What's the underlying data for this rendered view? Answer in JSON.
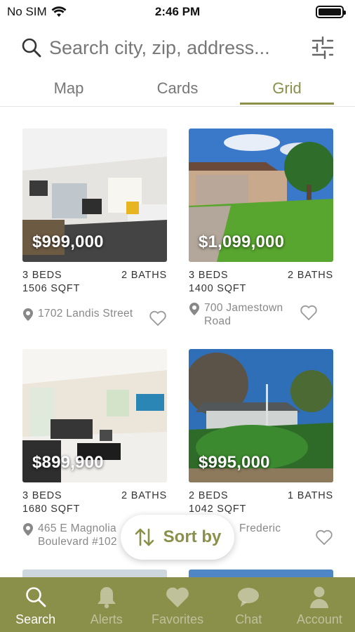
{
  "status_bar": {
    "carrier": "No SIM",
    "time": "2:46 PM"
  },
  "search": {
    "placeholder": "Search city, zip, address..."
  },
  "tabs": [
    {
      "label": "Map",
      "active": false
    },
    {
      "label": "Cards",
      "active": false
    },
    {
      "label": "Grid",
      "active": true
    }
  ],
  "listings": [
    {
      "price": "$999,000",
      "beds": "3 BEDS",
      "baths": "2 BATHS",
      "sqft": "1506 SQFT",
      "address": "1702 Landis Street",
      "photo": "modern-living-room-icon"
    },
    {
      "price": "$1,099,000",
      "beds": "3 BEDS",
      "baths": "2 BATHS",
      "sqft": "1400 SQFT",
      "address": "700 Jamestown Road",
      "photo": "house-exterior-garage-icon"
    },
    {
      "price": "$899,900",
      "beds": "3 BEDS",
      "baths": "2 BATHS",
      "sqft": "1680 SQFT",
      "address": "465 E Magnolia Boulevard #102",
      "photo": "living-room-sofa-icon"
    },
    {
      "price": "$995,000",
      "beds": "2 BEDS",
      "baths": "1 BATHS",
      "sqft": "1042 SQFT",
      "address": "Frederic",
      "photo": "house-exterior-trees-icon"
    }
  ],
  "sort": {
    "label": "Sort by"
  },
  "bottom_nav": [
    {
      "label": "Search",
      "icon": "search-icon",
      "active": true
    },
    {
      "label": "Alerts",
      "icon": "bell-icon",
      "active": false
    },
    {
      "label": "Favorites",
      "icon": "heart-icon",
      "active": false
    },
    {
      "label": "Chat",
      "icon": "chat-icon",
      "active": false
    },
    {
      "label": "Account",
      "icon": "person-icon",
      "active": false
    }
  ],
  "colors": {
    "accent": "#8a8f4a",
    "text": "#333333",
    "muted": "#888888"
  }
}
